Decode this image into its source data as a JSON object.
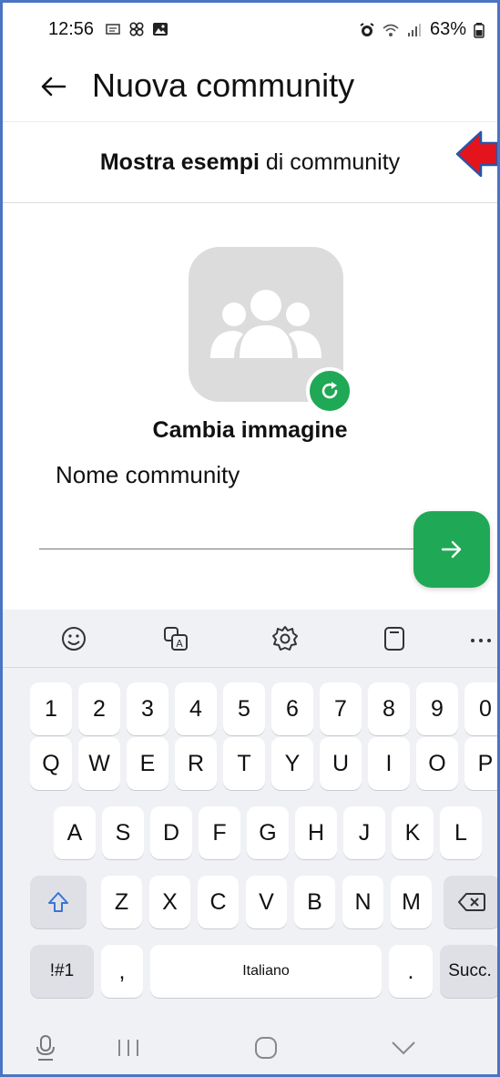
{
  "status_bar": {
    "time": "12:56",
    "battery": "63%"
  },
  "app_bar": {
    "title": "Nuova community"
  },
  "examples": {
    "bold_text": "Mostra esempi",
    "rest_text": " di community"
  },
  "avatar": {
    "change_label": "Cambia immagine"
  },
  "form": {
    "name_label": "Nome community",
    "name_value": ""
  },
  "colors": {
    "accent": "#1fa855",
    "frame_border": "#4a74c4",
    "annotation_arrow": "#e3141b"
  },
  "keyboard": {
    "toolbar_icons": [
      "emoji-icon",
      "translate-icon",
      "settings-icon",
      "clipboard-icon",
      "more-icon"
    ],
    "row_numbers": [
      "1",
      "2",
      "3",
      "4",
      "5",
      "6",
      "7",
      "8",
      "9",
      "0"
    ],
    "row_q": [
      "Q",
      "W",
      "E",
      "R",
      "T",
      "Y",
      "U",
      "I",
      "O",
      "P"
    ],
    "row_a": [
      "A",
      "S",
      "D",
      "F",
      "G",
      "H",
      "J",
      "K",
      "L"
    ],
    "row_z": [
      "Z",
      "X",
      "C",
      "V",
      "B",
      "N",
      "M"
    ],
    "symbols_label": "!#1",
    "comma_label": ",",
    "space_label": "Italiano",
    "period_label": ".",
    "enter_label": "Succ."
  }
}
